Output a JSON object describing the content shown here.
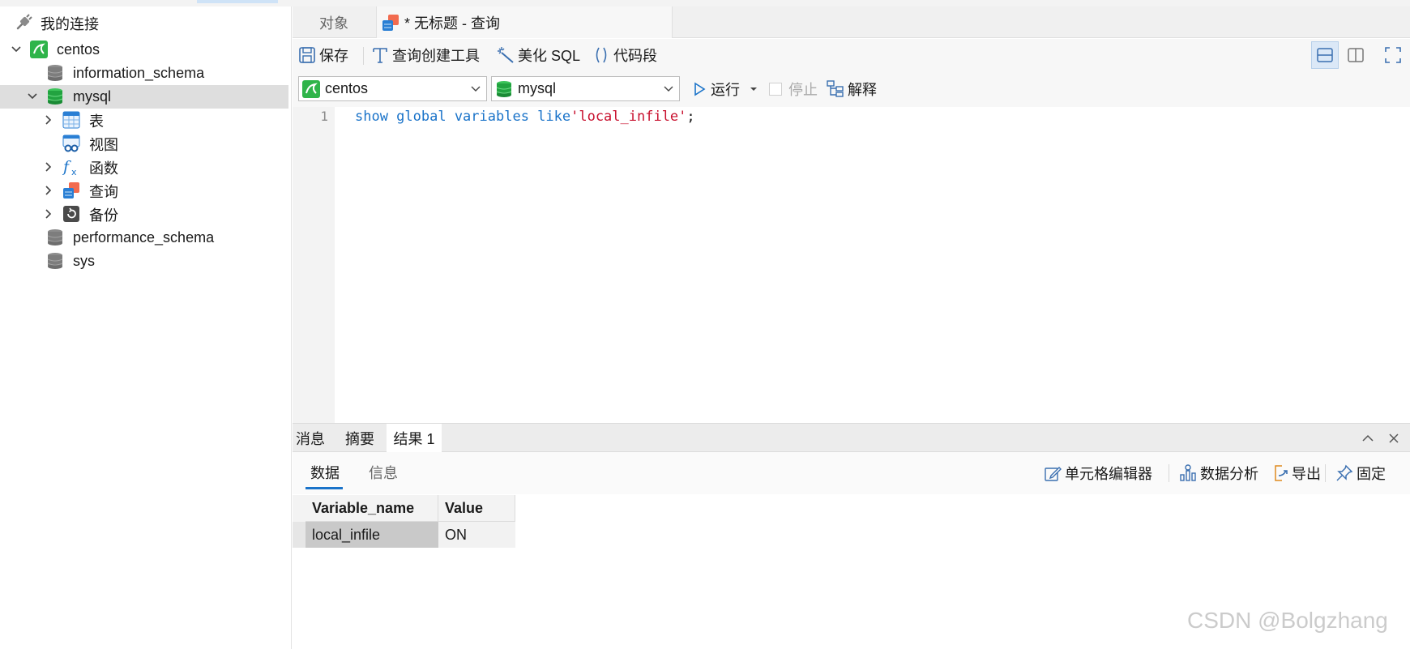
{
  "sidebar": {
    "connections_title": "我的连接",
    "connection": "centos",
    "databases": [
      "information_schema",
      "mysql",
      "performance_schema",
      "sys"
    ],
    "mysql_children": [
      "表",
      "视图",
      "函数",
      "查询",
      "备份"
    ]
  },
  "tabs": {
    "objects": "对象",
    "query_tab": "* 无标题 - 查询"
  },
  "toolbar": {
    "save": "保存",
    "query_builder": "查询创建工具",
    "beautify": "美化 SQL",
    "snippet": "代码段"
  },
  "toolbar2": {
    "connection_value": "centos",
    "database_value": "mysql",
    "run": "运行",
    "stop": "停止",
    "explain": "解释"
  },
  "editor": {
    "line_number": "1",
    "code_kw1": "show global variables like",
    "code_str": "'local_infile'",
    "code_end": ";"
  },
  "results": {
    "tabs": [
      "消息",
      "摘要",
      "结果 1"
    ],
    "subtabs": [
      "数据",
      "信息"
    ],
    "actions": {
      "cell_editor": "单元格编辑器",
      "data_analysis": "数据分析",
      "export": "导出",
      "pin": "固定"
    },
    "columns": [
      "Variable_name",
      "Value"
    ],
    "rows": [
      [
        "local_infile",
        "ON"
      ]
    ]
  },
  "watermark": "CSDN @Bolgzhang",
  "colors": {
    "accent": "#1a73c9",
    "keyword": "#1a73c9",
    "string": "#c8102e",
    "connection_green": "#2fb44a"
  }
}
